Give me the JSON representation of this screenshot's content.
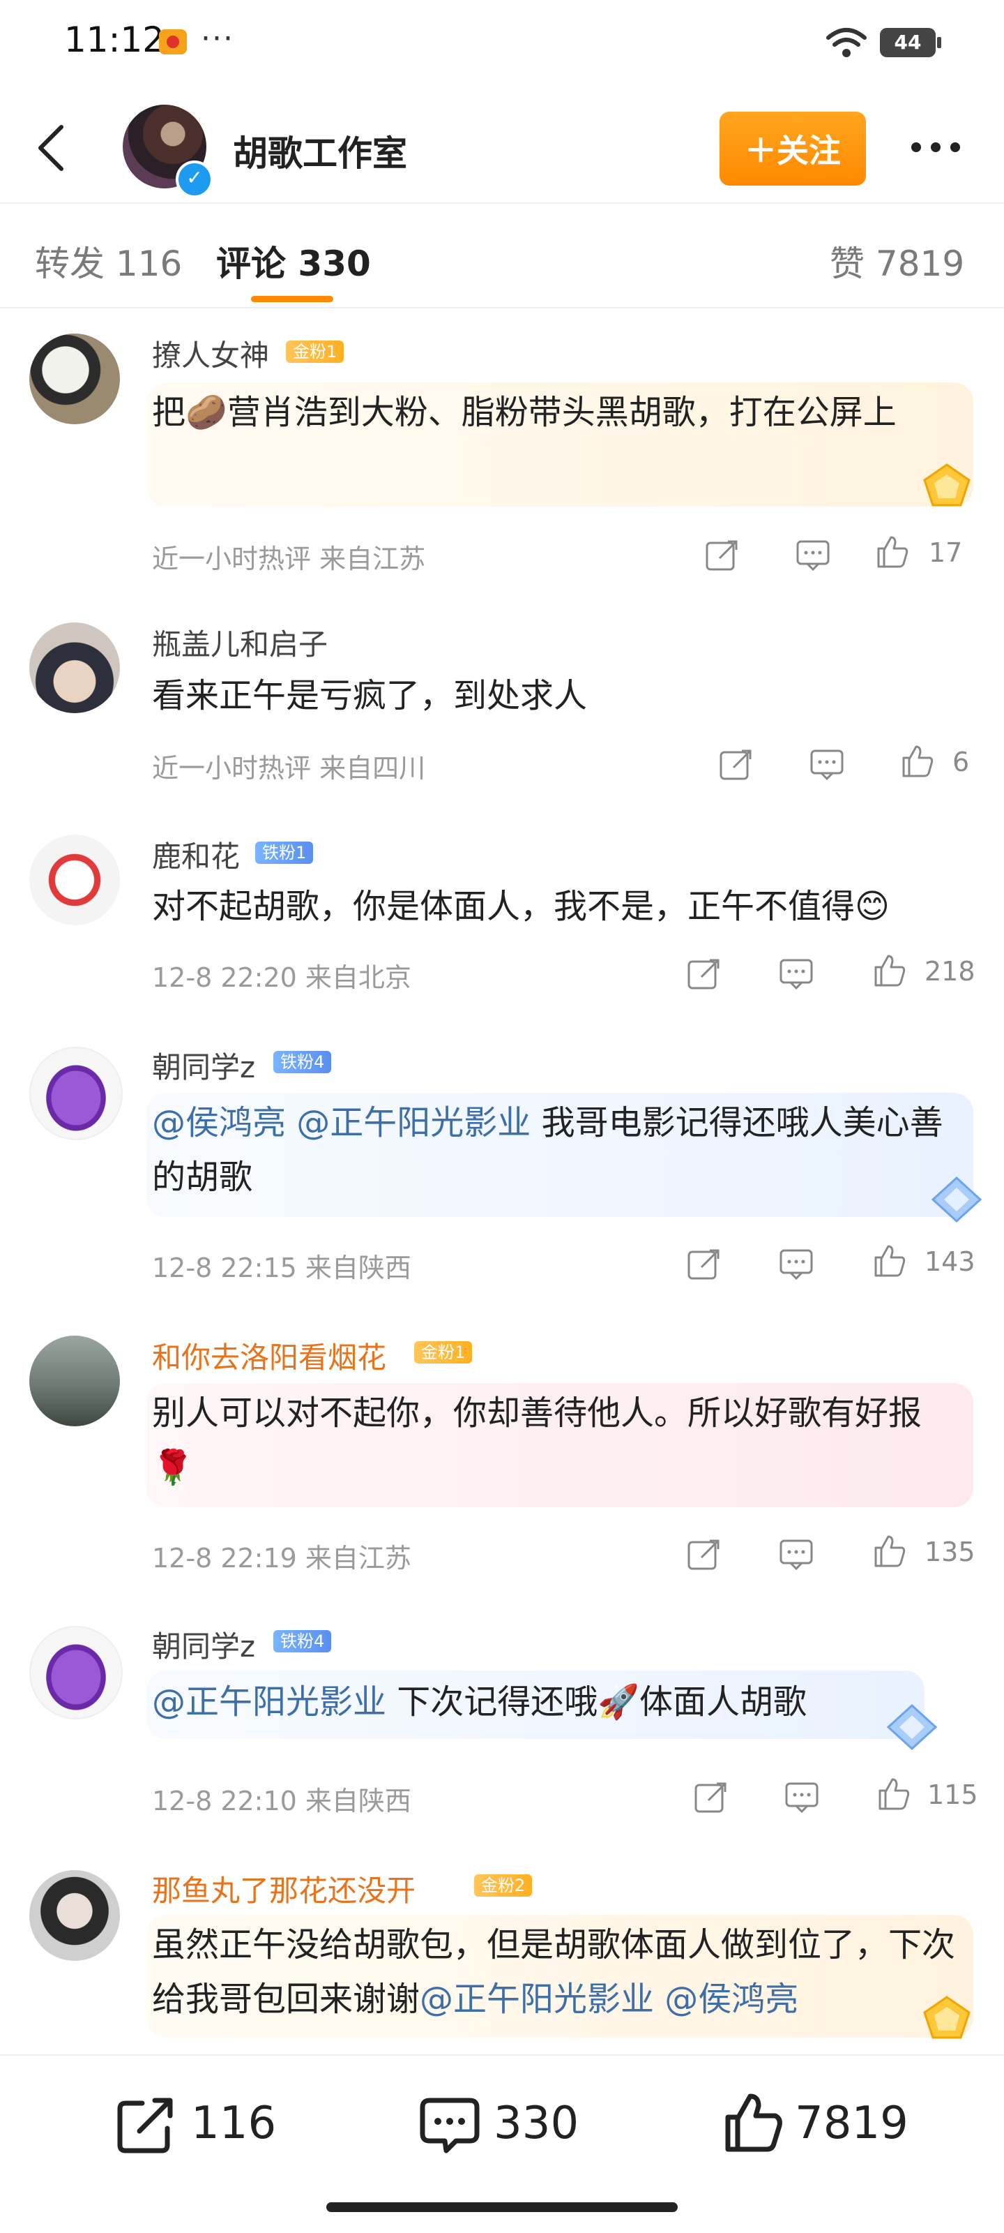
{
  "status_bar": {
    "time": "11:12",
    "dots": "···",
    "battery": "44"
  },
  "header": {
    "title": "胡歌工作室",
    "follow_label": "＋关注"
  },
  "tabs": [
    {
      "label": "转发 116"
    },
    {
      "label": "评论 330"
    },
    {
      "label": "赞 7819"
    }
  ],
  "comments": [
    {
      "name": "撩人女神",
      "badge": "金粉1",
      "text_parts": [
        "把🥔营肖浩到大粉、脂粉带头黑胡歌，打在公屏上"
      ],
      "meta": "近一小时热评  来自江苏",
      "likes": "17"
    },
    {
      "name": "瓶盖儿和启子",
      "badge": "",
      "text_parts": [
        "看来正午是亏疯了，到处求人"
      ],
      "meta": "近一小时热评  来自四川",
      "likes": "6"
    },
    {
      "name": "鹿和花",
      "badge": "铁粉1",
      "text_parts": [
        "对不起胡歌，你是体面人，我不是，正午不值得😊"
      ],
      "meta": "12-8 22:20  来自北京",
      "likes": "218"
    },
    {
      "name": "朝同学z",
      "badge": "铁粉4",
      "mentions": [
        "@侯鸿亮",
        "@正午阳光影业"
      ],
      "text_parts": [
        "我哥电影记得还哦人美心善的胡歌"
      ],
      "meta": "12-8 22:15  来自陕西",
      "likes": "143"
    },
    {
      "name": "和你去洛阳看烟花",
      "badge": "金粉1",
      "text_parts": [
        "别人可以对不起你，你却善待他人。所以好歌有好报🌹"
      ],
      "meta": "12-8 22:19  来自江苏",
      "likes": "135"
    },
    {
      "name": "朝同学z",
      "badge": "铁粉4",
      "mentions": [
        "@正午阳光影业"
      ],
      "text_parts": [
        "下次记得还哦🚀体面人胡歌"
      ],
      "meta": "12-8 22:10  来自陕西",
      "likes": "115"
    },
    {
      "name": "那鱼丸了那花还没开",
      "badge": "金粉2",
      "mentions": [
        "@正午阳光影业",
        "@侯鸿亮"
      ],
      "text_parts": [
        "虽然正午没给胡歌包，但是胡歌体面人做到位了，下次给我哥包回来谢谢"
      ]
    }
  ],
  "bottom_bar": {
    "reposts": "116",
    "comments": "330",
    "likes": "7819"
  },
  "colors": {
    "accent": "#ff8a00",
    "mention": "#3e6ea8",
    "name_orange": "#e8731a"
  }
}
